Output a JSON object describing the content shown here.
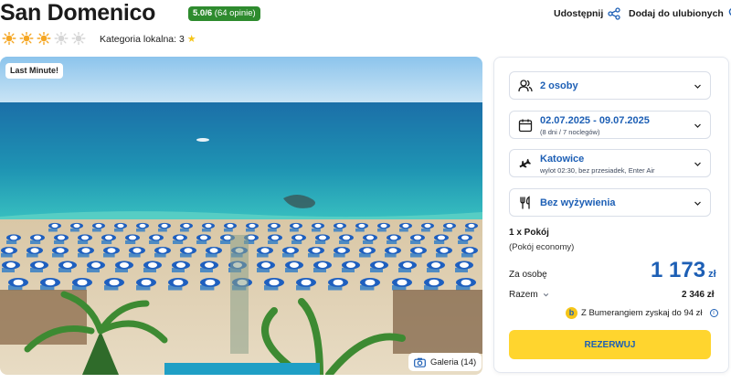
{
  "hotel": {
    "name": "San Domenico",
    "rating_score": "5.0/6",
    "rating_count": "(64 opinie)",
    "sun_rating": 3,
    "sun_max": 5,
    "category_label": "Kategoria lokalna: 3"
  },
  "actions": {
    "share_label": "Udostępnij",
    "favorite_label": "Dodaj do ulubionych"
  },
  "photo": {
    "badge": "Last Minute!",
    "gallery_label": "Galeria (14)"
  },
  "booking": {
    "persons": "2 osoby",
    "dates": "02.07.2025 - 09.07.2025",
    "dates_sub": "(8 dni / 7 noclegów)",
    "departure_city": "Katowice",
    "departure_sub": "wylot 02:30, bez przesiadek, Enter Air",
    "board": "Bez wyżywienia",
    "room_count": "1 x Pokój",
    "room_type": "(Pokój economy)",
    "per_person_label": "Za osobę",
    "per_person_price": "1 173",
    "currency": "zł",
    "total_label": "Razem",
    "total_price": "2 346 zł",
    "bumerang_text": "Z Bumerangiem zyskaj do 94 zł",
    "book_button": "REZERWUJ"
  },
  "icons": {
    "sun": "sun-icon",
    "share": "share-icon",
    "heart": "heart-icon",
    "persons": "persons-icon",
    "calendar": "calendar-icon",
    "plane": "plane-icon",
    "cutlery": "cutlery-icon",
    "chevron": "chevron-down-icon",
    "camera": "camera-icon"
  },
  "colors": {
    "accent_blue": "#1d5fb5",
    "rating_green": "#2e8b2e",
    "sun_active": "#f5a623",
    "sun_inactive": "#d6d6d6",
    "button_yellow": "#ffd52e"
  }
}
